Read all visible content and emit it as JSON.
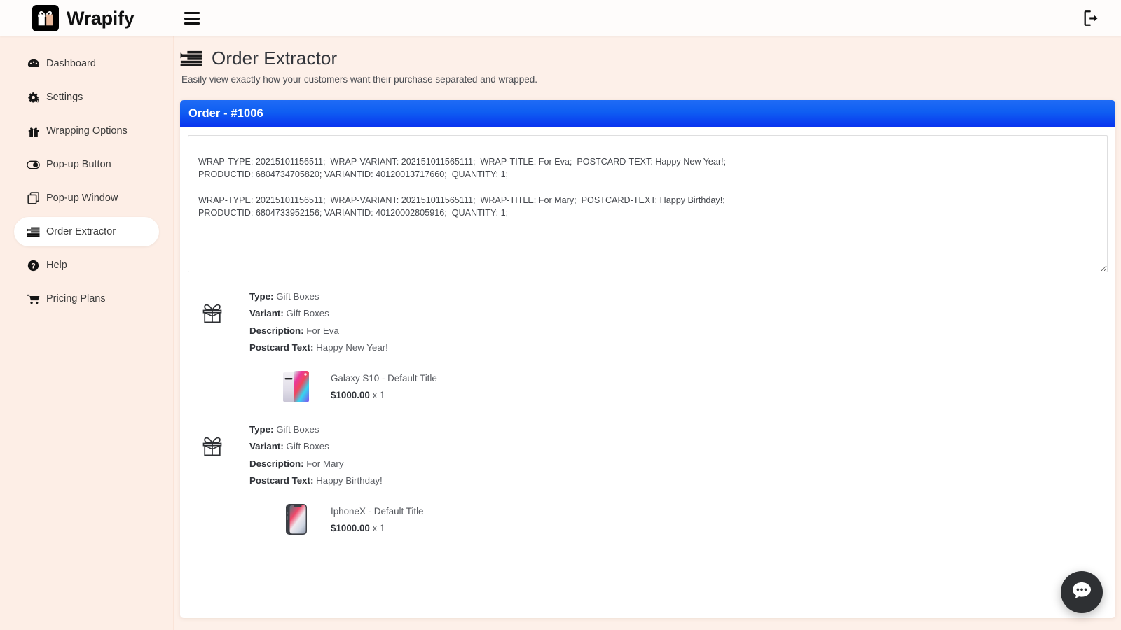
{
  "brand": {
    "name": "Wrapify",
    "logo_icon": "gift-logo-icon",
    "menu_icon": "hamburger-menu-icon",
    "logout_icon": "logout-icon"
  },
  "sidebar": {
    "items": [
      {
        "label": "Dashboard",
        "icon": "dashboard-icon",
        "active": false
      },
      {
        "label": "Settings",
        "icon": "gear-icon",
        "active": false
      },
      {
        "label": "Wrapping Options",
        "icon": "gift-icon",
        "active": false
      },
      {
        "label": "Pop-up Button",
        "icon": "toggle-icon",
        "active": false
      },
      {
        "label": "Pop-up Window",
        "icon": "window-copy-icon",
        "active": false
      },
      {
        "label": "Order Extractor",
        "icon": "list-extract-icon",
        "active": true
      },
      {
        "label": "Help",
        "icon": "question-circle-icon",
        "active": false
      },
      {
        "label": "Pricing Plans",
        "icon": "shopping-cart-icon",
        "active": false
      }
    ]
  },
  "page": {
    "icon": "list-extract-icon",
    "title": "Order Extractor",
    "subtitle": "Easily view exactly how your customers want their purchase separated and wrapped."
  },
  "card": {
    "header_title": "Order - #1006",
    "extract_textarea": {
      "name": "order-extract-textarea",
      "value": "WRAP-TYPE: 20215101156511;  WRAP-VARIANT: 202151011565111;  WRAP-TITLE: For Eva;  POSTCARD-TEXT: Happy New Year!;\nPRODUCTID: 6804734705820; VARIANTID: 40120013717660;  QUANTITY: 1;\n\nWRAP-TYPE: 20215101156511;  WRAP-VARIANT: 202151011565111;  WRAP-TITLE: For Mary;  POSTCARD-TEXT: Happy Birthday!;\nPRODUCTID: 6804733952156; VARIANTID: 40120002805916;  QUANTITY: 1;",
      "placeholder": ""
    },
    "labels": {
      "type": "Type:",
      "variant": "Variant:",
      "description": "Description:",
      "postcard_text": "Postcard Text:"
    },
    "groups": [
      {
        "icon": "gift-box-icon",
        "type": "Gift Boxes",
        "variant": "Gift Boxes",
        "description": "For Eva",
        "postcard_text": "Happy New Year!",
        "product": {
          "thumb": "galaxy-s10-thumbnail",
          "title": "Galaxy S10 - Default Title",
          "price": "$1000.00",
          "quantity": "x 1"
        }
      },
      {
        "icon": "gift-box-icon",
        "type": "Gift Boxes",
        "variant": "Gift Boxes",
        "description": "For Mary",
        "postcard_text": "Happy Birthday!",
        "product": {
          "thumb": "iphonex-thumbnail",
          "title": "IphoneX - Default Title",
          "price": "$1000.00",
          "quantity": "x 1"
        }
      }
    ]
  },
  "chat": {
    "icon": "chat-bubble-icon"
  },
  "colors": {
    "page_bg": "#fdf0e9",
    "sidebar_bg": "#fdeee6",
    "card_header_blue_top": "#1f6bf5",
    "card_header_blue_bottom": "#0934ef",
    "topbar_bg": "#fefcfb",
    "chat_fab_bg": "#2e3033"
  }
}
